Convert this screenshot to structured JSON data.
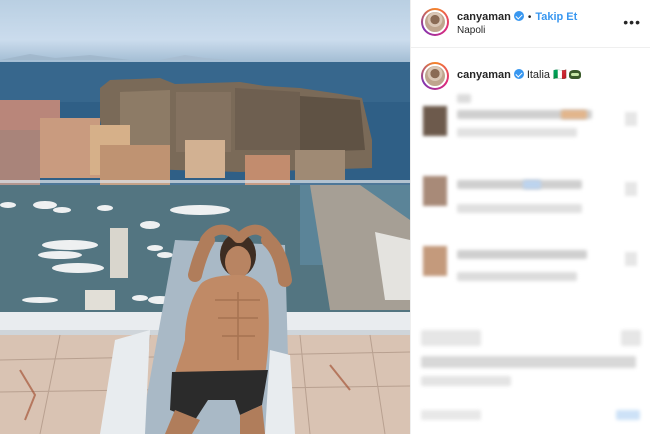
{
  "post": {
    "username": "canyaman",
    "follow_label": "Takip Et",
    "location": "Napoli",
    "caption_text": "Italia 🇮🇹",
    "caption_emoji": "car-emoji"
  },
  "icons": {
    "verified": "verified-badge-icon",
    "more": "more-options-icon"
  },
  "colors": {
    "follow_accent": "#3897f0",
    "text": "#262626",
    "divider": "#efefef"
  }
}
